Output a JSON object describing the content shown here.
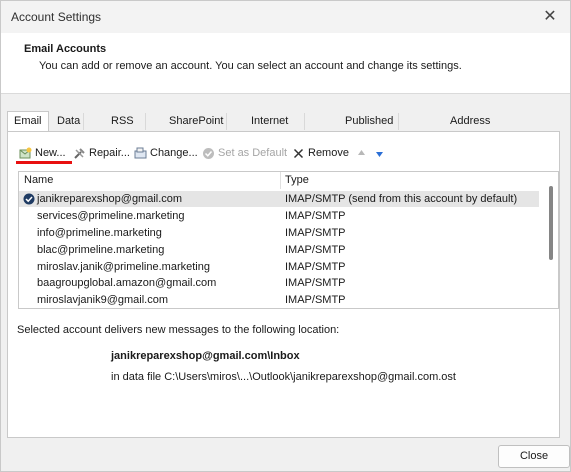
{
  "window": {
    "title": "Account Settings",
    "close_glyph": "✕"
  },
  "header": {
    "title": "Email Accounts",
    "subtitle": "You can add or remove an account. You can select an account and change its settings."
  },
  "tabs": [
    {
      "label": "Email",
      "active": true
    },
    {
      "label": "Data Files"
    },
    {
      "label": "RSS Feeds"
    },
    {
      "label": "SharePoint Lists"
    },
    {
      "label": "Internet Calendars"
    },
    {
      "label": "Published Calendars"
    },
    {
      "label": "Address Books"
    }
  ],
  "toolbar": {
    "new_label": "New...",
    "repair_label": "Repair...",
    "change_label": "Change...",
    "set_default_label": "Set as Default",
    "remove_label": "Remove"
  },
  "accounts": {
    "col_name": "Name",
    "col_type": "Type",
    "rows": [
      {
        "name": "janikreparexshop@gmail.com",
        "type": "IMAP/SMTP (send from this account by default)",
        "default": true
      },
      {
        "name": "services@primeline.marketing",
        "type": "IMAP/SMTP"
      },
      {
        "name": "info@primeline.marketing",
        "type": "IMAP/SMTP"
      },
      {
        "name": "blac@primeline.marketing",
        "type": "IMAP/SMTP"
      },
      {
        "name": "miroslav.janik@primeline.marketing",
        "type": "IMAP/SMTP"
      },
      {
        "name": "baagroupglobal.amazon@gmail.com",
        "type": "IMAP/SMTP"
      },
      {
        "name": "miroslavjanik9@gmail.com",
        "type": "IMAP/SMTP"
      }
    ]
  },
  "delivery": {
    "text": "Selected account delivers new messages to the following location:",
    "folder": "janikreparexshop@gmail.com\\Inbox",
    "data_file": "in data file C:\\Users\\miros\\...\\Outlook\\janikreparexshop@gmail.com.ost"
  },
  "buttons": {
    "close": "Close"
  },
  "colors": {
    "highlight": "#e81010",
    "accent": "#2b6fd6",
    "selected_row": "#e5e5e5"
  }
}
